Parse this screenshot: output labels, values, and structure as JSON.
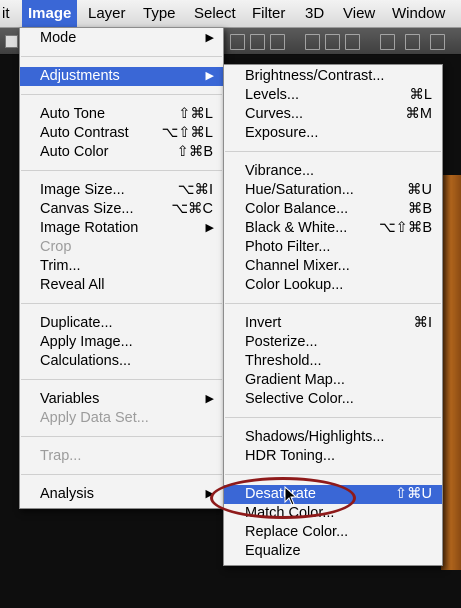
{
  "menubar": {
    "items": [
      {
        "label": "it"
      },
      {
        "label": "Image"
      },
      {
        "label": "Layer"
      },
      {
        "label": "Type"
      },
      {
        "label": "Select"
      },
      {
        "label": "Filter"
      },
      {
        "label": "3D"
      },
      {
        "label": "View"
      },
      {
        "label": "Window"
      }
    ]
  },
  "image_menu": {
    "items": [
      {
        "label": "Mode",
        "shortcut": "",
        "arrow": "▶"
      },
      {
        "label": "Adjustments",
        "shortcut": "",
        "arrow": "▶"
      },
      {
        "label": "Auto Tone",
        "shortcut": "⇧⌘L"
      },
      {
        "label": "Auto Contrast",
        "shortcut": "⌥⇧⌘L"
      },
      {
        "label": "Auto Color",
        "shortcut": "⇧⌘B"
      },
      {
        "label": "Image Size...",
        "shortcut": "⌥⌘I"
      },
      {
        "label": "Canvas Size...",
        "shortcut": "⌥⌘C"
      },
      {
        "label": "Image Rotation",
        "shortcut": "",
        "arrow": "▶"
      },
      {
        "label": "Crop",
        "shortcut": ""
      },
      {
        "label": "Trim...",
        "shortcut": ""
      },
      {
        "label": "Reveal All",
        "shortcut": ""
      },
      {
        "label": "Duplicate...",
        "shortcut": ""
      },
      {
        "label": "Apply Image...",
        "shortcut": ""
      },
      {
        "label": "Calculations...",
        "shortcut": ""
      },
      {
        "label": "Variables",
        "shortcut": "",
        "arrow": "▶"
      },
      {
        "label": "Apply Data Set...",
        "shortcut": ""
      },
      {
        "label": "Trap...",
        "shortcut": ""
      },
      {
        "label": "Analysis",
        "shortcut": "",
        "arrow": "▶"
      }
    ]
  },
  "adjustments_menu": {
    "items": [
      {
        "label": "Brightness/Contrast...",
        "shortcut": ""
      },
      {
        "label": "Levels...",
        "shortcut": "⌘L"
      },
      {
        "label": "Curves...",
        "shortcut": "⌘M"
      },
      {
        "label": "Exposure...",
        "shortcut": ""
      },
      {
        "label": "Vibrance...",
        "shortcut": ""
      },
      {
        "label": "Hue/Saturation...",
        "shortcut": "⌘U"
      },
      {
        "label": "Color Balance...",
        "shortcut": "⌘B"
      },
      {
        "label": "Black & White...",
        "shortcut": "⌥⇧⌘B"
      },
      {
        "label": "Photo Filter...",
        "shortcut": ""
      },
      {
        "label": "Channel Mixer...",
        "shortcut": ""
      },
      {
        "label": "Color Lookup...",
        "shortcut": ""
      },
      {
        "label": "Invert",
        "shortcut": "⌘I"
      },
      {
        "label": "Posterize...",
        "shortcut": ""
      },
      {
        "label": "Threshold...",
        "shortcut": ""
      },
      {
        "label": "Gradient Map...",
        "shortcut": ""
      },
      {
        "label": "Selective Color...",
        "shortcut": ""
      },
      {
        "label": "Shadows/Highlights...",
        "shortcut": ""
      },
      {
        "label": "HDR Toning...",
        "shortcut": ""
      },
      {
        "label": "Desaturate",
        "shortcut": "⇧⌘U"
      },
      {
        "label": "Match Color...",
        "shortcut": ""
      },
      {
        "label": "Replace Color...",
        "shortcut": ""
      },
      {
        "label": "Equalize",
        "shortcut": ""
      }
    ]
  },
  "colors": {
    "highlight": "#3a67d6",
    "annotation_ring": "#8e1a1a"
  }
}
